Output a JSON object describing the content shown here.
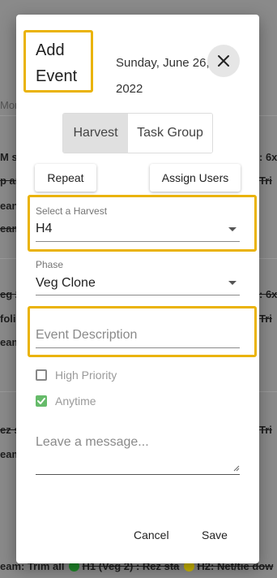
{
  "background": {
    "tab_partial": "Mor",
    "rows": [
      {
        "left": "M s",
        "right": ": 6x"
      },
      {
        "left": "p ar",
        "right": "Tri"
      },
      {
        "left": "ean",
        "right": ""
      },
      {
        "left": "eam",
        "right": ""
      },
      {
        "left": "eg 2",
        "right": ": 6x"
      },
      {
        "left": "folia",
        "right": "Tri"
      },
      {
        "left": "eam",
        "right": ""
      },
      {
        "left": "ez st",
        "right": "Tri"
      },
      {
        "left": "eam",
        "right": ""
      }
    ],
    "footer": {
      "item1": "eam: Trim all",
      "item2": "H1 (Veg 2) : Rez sta",
      "item3": "H2: Net/tie dow"
    },
    "colors": {
      "green": "#1f8a2a",
      "yellow": "#cdb700"
    }
  },
  "modal": {
    "title_line1": "Add",
    "title_line2": "Event",
    "date": "Sunday, June 26, 2022",
    "close_icon": "close-icon",
    "toggle": {
      "option1": "Harvest",
      "option2": "Task Group",
      "selected": "Harvest"
    },
    "repeat_label": "Repeat",
    "assign_label": "Assign Users",
    "harvest_field": {
      "label": "Select a Harvest",
      "value": "H4"
    },
    "phase_field": {
      "label": "Phase",
      "value": "Veg Clone"
    },
    "description_placeholder": "Event Description",
    "high_priority": {
      "label": "High Priority",
      "checked": false
    },
    "anytime": {
      "label": "Anytime",
      "checked": true
    },
    "message_placeholder": "Leave a message...",
    "cancel_label": "Cancel",
    "save_label": "Save",
    "highlight_color": "#eab308",
    "check_color": "#4caf50"
  }
}
